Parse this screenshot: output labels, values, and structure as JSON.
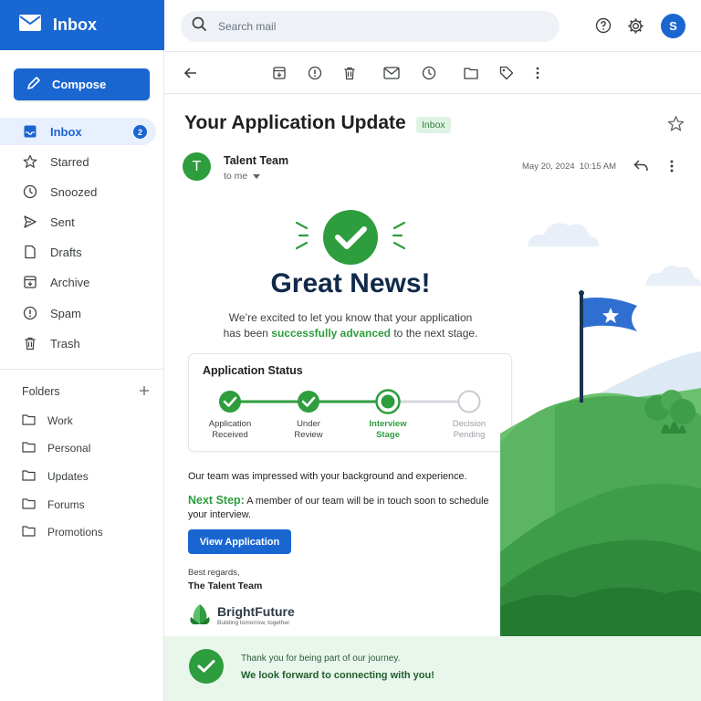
{
  "app": {
    "title": "Inbox"
  },
  "sidebar": {
    "compose_label": "Compose",
    "items": [
      {
        "label": "Inbox",
        "icon": "inbox-icon",
        "badge": "2",
        "active": true
      },
      {
        "label": "Starred",
        "icon": "star-icon"
      },
      {
        "label": "Snoozed",
        "icon": "clock-icon"
      },
      {
        "label": "Sent",
        "icon": "send-icon"
      },
      {
        "label": "Drafts",
        "icon": "draft-icon"
      },
      {
        "label": "Archive",
        "icon": "archive-icon"
      },
      {
        "label": "Spam",
        "icon": "spam-icon"
      },
      {
        "label": "Trash",
        "icon": "trash-icon"
      }
    ],
    "folders_title": "Folders",
    "folders": [
      "Work",
      "Personal",
      "Updates",
      "Forums",
      "Promotions"
    ]
  },
  "search": {
    "placeholder": "Search mail"
  },
  "user": {
    "initial": "S"
  },
  "email": {
    "subject": "Your Application Update",
    "label": "Inbox",
    "sender_initial": "T",
    "sender_name": "Talent Team",
    "to": "to me",
    "date": "May 20, 2024",
    "time": "10:15 AM",
    "headline": "Great News!",
    "intro_1": "We’re excited to let you know that your application",
    "intro_2a": "has been ",
    "intro_highlight": "successfully advanced",
    "intro_2b": " to the next stage.",
    "status": {
      "title": "Application Status",
      "steps": [
        {
          "line1": "Application",
          "line2": "Received",
          "state": "done"
        },
        {
          "line1": "Under",
          "line2": "Review",
          "state": "done"
        },
        {
          "line1": "Interview",
          "line2": "Stage",
          "state": "current"
        },
        {
          "line1": "Decision",
          "line2": "Pending",
          "state": "pending"
        }
      ]
    },
    "paragraph": "Our team was impressed with your background and experience.",
    "next_label": "Next Step:",
    "next_text": " A member of our team will be in touch soon to schedule your interview.",
    "button": "View Application",
    "regards": "Best regards,",
    "signature": "The Talent Team",
    "company": "BrightFuture",
    "tagline": "Building tomorrow, together.",
    "footer_1": "Thank you for being part of our journey.",
    "footer_2": "We look forward to connecting with you!"
  },
  "colors": {
    "primary": "#1a66d1",
    "success": "#2e9d3d",
    "headline": "#112a4a",
    "footer_bg": "#e9f6ec"
  }
}
